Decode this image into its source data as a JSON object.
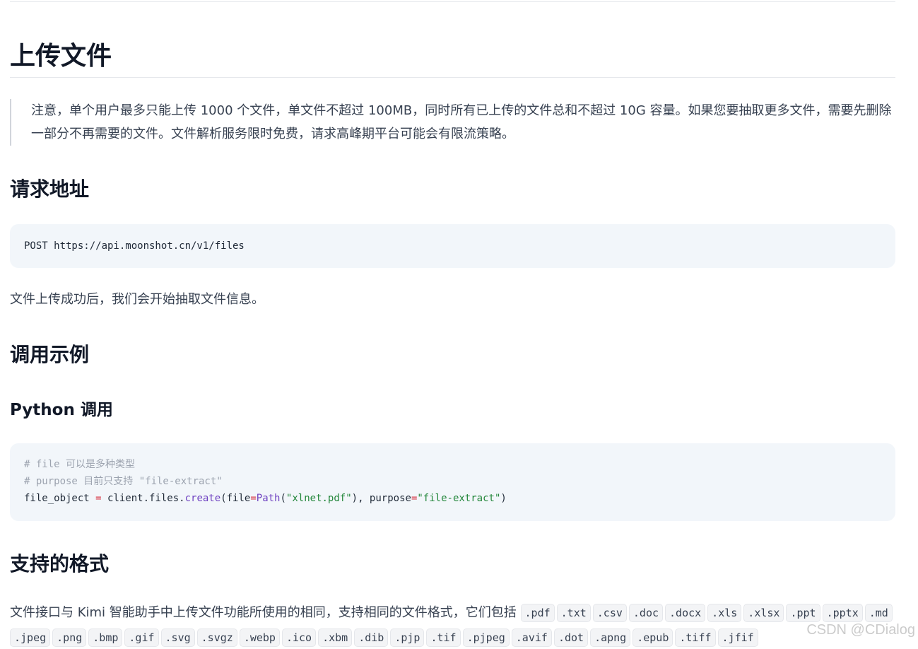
{
  "upload": {
    "title": "上传文件",
    "note": "注意，单个用户最多只能上传 1000 个文件，单文件不超过 100MB，同时所有已上传的文件总和不超过 10G 容量。如果您要抽取更多文件，需要先删除一部分不再需要的文件。文件解析服务限时免费，请求高峰期平台可能会有限流策略。"
  },
  "request": {
    "heading": "请求地址",
    "endpoint": "POST https://api.moonshot.cn/v1/files",
    "after_text": "文件上传成功后，我们会开始抽取文件信息。"
  },
  "example": {
    "heading": "调用示例",
    "python_heading": "Python 调用",
    "comment1": "# file 可以是多种类型",
    "comment2": "# purpose 目前只支持 \"file-extract\"",
    "code": {
      "var": "file_object",
      "eq": " = ",
      "obj": "client.files.",
      "func": "create",
      "open": "(file",
      "eq2": "=",
      "cls": "Path",
      "arg_open": "(",
      "path": "\"xlnet.pdf\"",
      "arg_close": "), purpose",
      "eq3": "=",
      "purpose": "\"file-extract\"",
      "close": ")"
    }
  },
  "formats": {
    "heading": "支持的格式",
    "intro": "文件接口与 Kimi 智能助手中上传文件功能所使用的相同，支持相同的文件格式，它们包括",
    "list": [
      ".pdf",
      ".txt",
      ".csv",
      ".doc",
      ".docx",
      ".xls",
      ".xlsx",
      ".ppt",
      ".pptx",
      ".md",
      ".jpeg",
      ".png",
      ".bmp",
      ".gif",
      ".svg",
      ".svgz",
      ".webp",
      ".ico",
      ".xbm",
      ".dib",
      ".pjp",
      ".tif",
      ".pjpeg",
      ".avif",
      ".dot",
      ".apng",
      ".epub",
      ".tiff",
      ".jfif"
    ]
  },
  "watermark": "CSDN @CDialog"
}
